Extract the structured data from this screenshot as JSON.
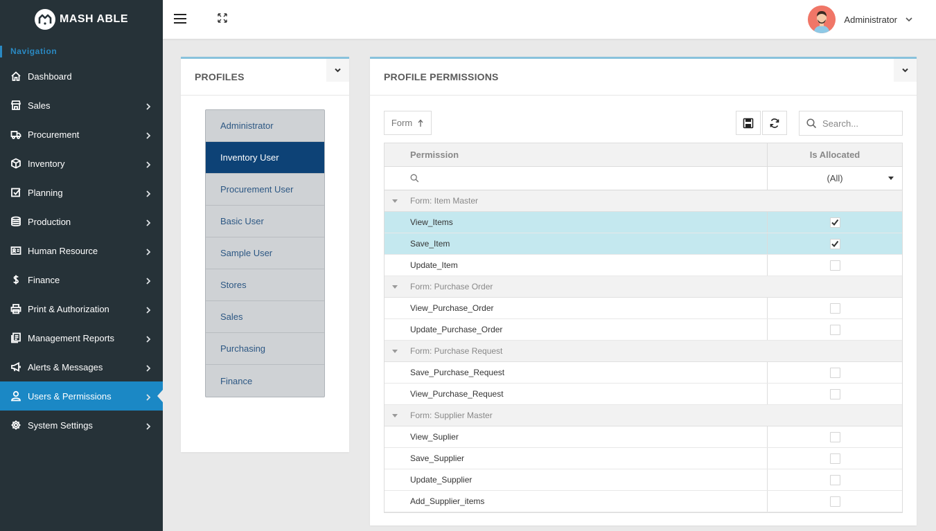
{
  "app": {
    "brand": "MASH ABLE"
  },
  "sidebar": {
    "section_label": "Navigation",
    "items": [
      {
        "label": "Dashboard",
        "icon": "home-icon",
        "chevron": false
      },
      {
        "label": "Sales",
        "icon": "shop-icon",
        "chevron": true
      },
      {
        "label": "Procurement",
        "icon": "truck-icon",
        "chevron": true
      },
      {
        "label": "Inventory",
        "icon": "box-icon",
        "chevron": true
      },
      {
        "label": "Planning",
        "icon": "check-square-icon",
        "chevron": true
      },
      {
        "label": "Production",
        "icon": "database-icon",
        "chevron": true
      },
      {
        "label": "Human Resource",
        "icon": "id-card-icon",
        "chevron": true
      },
      {
        "label": "Finance",
        "icon": "dollar-icon",
        "chevron": true
      },
      {
        "label": "Print & Authorization",
        "icon": "printer-icon",
        "chevron": true
      },
      {
        "label": "Management Reports",
        "icon": "report-icon",
        "chevron": true
      },
      {
        "label": "Alerts & Messages",
        "icon": "megaphone-icon",
        "chevron": true
      },
      {
        "label": "Users & Permissions",
        "icon": "user-icon",
        "chevron": true,
        "active": true
      },
      {
        "label": "System Settings",
        "icon": "gear-icon",
        "chevron": true
      }
    ]
  },
  "header": {
    "user_name": "Administrator"
  },
  "profiles_card": {
    "title": "PROFILES",
    "items": [
      "Administrator",
      "Inventory User",
      "Procurement User",
      "Basic User",
      "Sample User",
      "Stores",
      "Sales",
      "Purchasing",
      "Finance"
    ],
    "selected": "Inventory User"
  },
  "permissions_card": {
    "title": "PROFILE PERMISSIONS",
    "group_chip": "Form",
    "search_placeholder": "Search...",
    "columns": {
      "permission": "Permission",
      "allocated": "Is Allocated"
    },
    "filter_allocated": "(All)",
    "groups": [
      {
        "label": "Form: Item Master",
        "rows": [
          {
            "name": "View_Items",
            "allocated": true
          },
          {
            "name": "Save_Item",
            "allocated": true
          },
          {
            "name": "Update_Item",
            "allocated": false
          }
        ]
      },
      {
        "label": "Form: Purchase Order",
        "rows": [
          {
            "name": "View_Purchase_Order",
            "allocated": false
          },
          {
            "name": "Update_Purchase_Order",
            "allocated": false
          }
        ]
      },
      {
        "label": "Form: Purchase Request",
        "rows": [
          {
            "name": "Save_Purchase_Request",
            "allocated": false
          },
          {
            "name": "View_Purchase_Request",
            "allocated": false
          }
        ]
      },
      {
        "label": "Form: Supplier Master",
        "rows": [
          {
            "name": "View_Suplier",
            "allocated": false
          },
          {
            "name": "Save_Supplier",
            "allocated": false
          },
          {
            "name": "Update_Supplier",
            "allocated": false
          },
          {
            "name": "Add_Supplier_items",
            "allocated": false
          }
        ]
      }
    ]
  },
  "colors": {
    "sidebar_bg": "#263238",
    "active_nav": "#1b88c5",
    "selected_profile": "#0d4276",
    "selected_row": "#c4e8ef",
    "card_top_border": "#88c2dc"
  }
}
